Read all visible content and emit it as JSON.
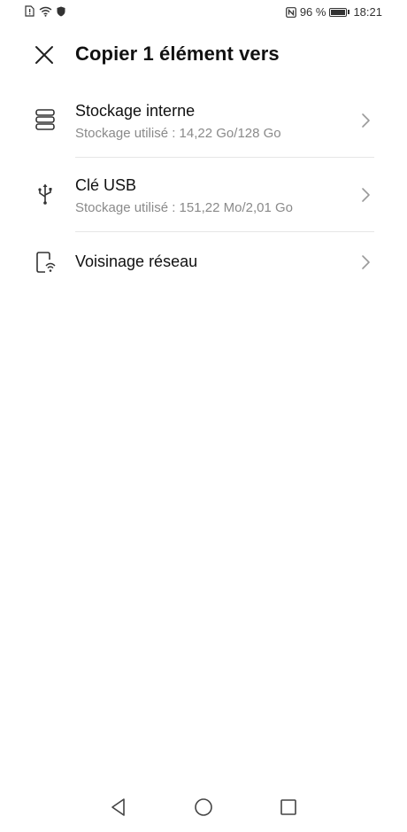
{
  "status_bar": {
    "battery_percent": "96 %",
    "battery_level": 0.96,
    "time": "18:21",
    "left_icons": [
      "sim-alert-icon",
      "wifi-icon",
      "shield-icon"
    ],
    "right_icons": [
      "nfc-icon",
      "battery-icon"
    ]
  },
  "header": {
    "title": "Copier 1 élément vers",
    "close_icon": "close-icon"
  },
  "locations": [
    {
      "icon": "storage-icon",
      "title": "Stockage interne",
      "subtitle": "Stockage utilisé : 14,22  Go/128  Go"
    },
    {
      "icon": "usb-icon",
      "title": "Clé USB",
      "subtitle": "Stockage utilisé : 151,22  Mo/2,01  Go"
    },
    {
      "icon": "network-neighborhood-icon",
      "title": "Voisinage réseau"
    }
  ],
  "nav_bar": {
    "icons": [
      "back-icon",
      "home-icon",
      "recents-icon"
    ]
  },
  "colors": {
    "text_primary": "#111111",
    "text_secondary": "#8a8a8a",
    "divider": "#e6e6e6",
    "icon": "#333333"
  }
}
